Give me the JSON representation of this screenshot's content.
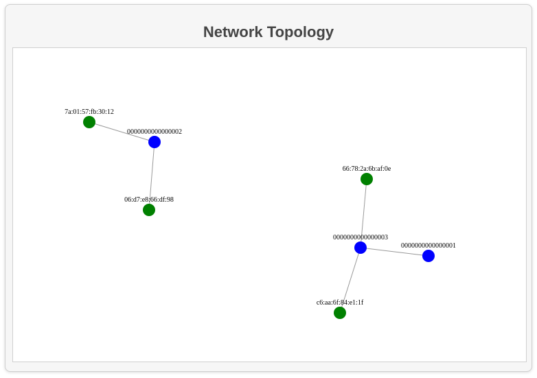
{
  "title": "Network Topology",
  "colors": {
    "switch": "#0000ff",
    "host": "#008000",
    "link": "#999999"
  },
  "nodes": [
    {
      "id": "0000000000000002",
      "type": "switch",
      "label": "0000000000000002"
    },
    {
      "id": "7a:01:57:fb:30:12",
      "type": "host",
      "label": "7a:01:57:fb:30:12"
    },
    {
      "id": "06:d7:e8:66:df:98",
      "type": "host",
      "label": "06:d7:e8:66:df:98"
    },
    {
      "id": "0000000000000003",
      "type": "switch",
      "label": "0000000000000003"
    },
    {
      "id": "0000000000000001",
      "type": "switch",
      "label": "0000000000000001"
    },
    {
      "id": "66:78:2a:6b:af:0e",
      "type": "host",
      "label": "66:78:2a:6b:af:0e"
    },
    {
      "id": "c6:aa:6f:84:e1:1f",
      "type": "host",
      "label": "c6:aa:6f:84:e1:1f"
    }
  ],
  "links": [
    {
      "source": "7a:01:57:fb:30:12",
      "target": "0000000000000002"
    },
    {
      "source": "0000000000000002",
      "target": "06:d7:e8:66:df:98"
    },
    {
      "source": "66:78:2a:6b:af:0e",
      "target": "0000000000000003"
    },
    {
      "source": "0000000000000003",
      "target": "0000000000000001"
    },
    {
      "source": "0000000000000003",
      "target": "c6:aa:6f:84:e1:1f"
    }
  ]
}
